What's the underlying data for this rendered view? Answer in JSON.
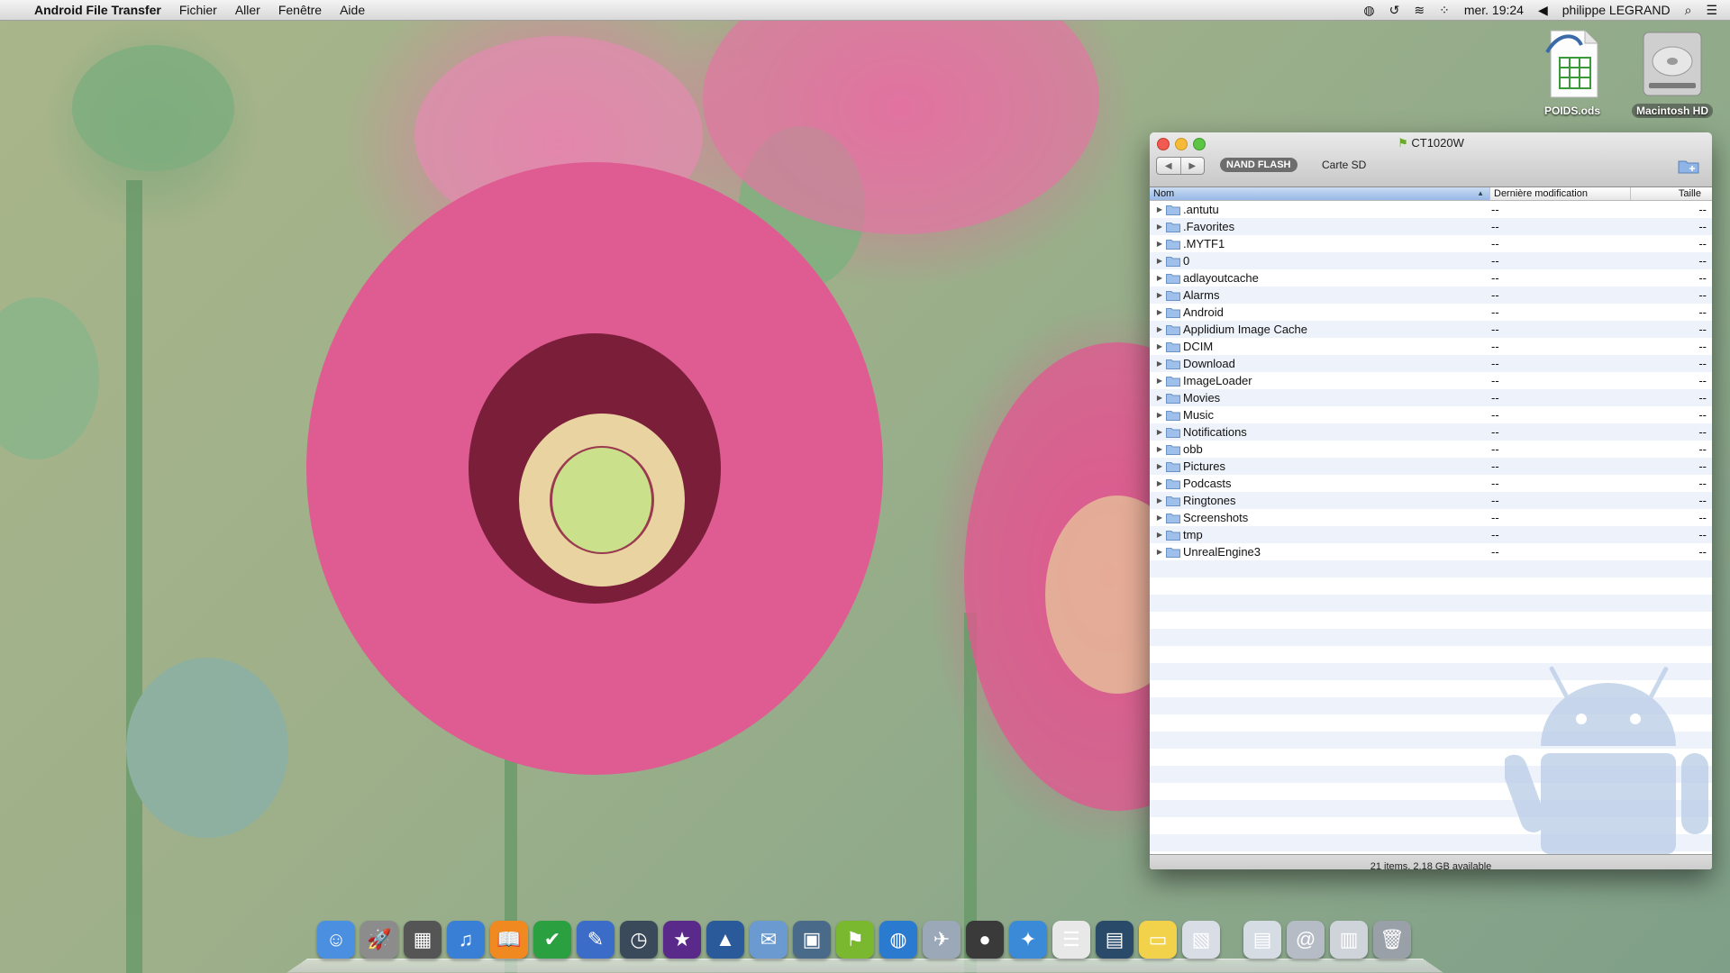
{
  "menubar": {
    "app_name": "Android File Transfer",
    "menus": [
      "Fichier",
      "Aller",
      "Fenêtre",
      "Aide"
    ],
    "clock": "mer. 19:24",
    "user": "philippe LEGRAND"
  },
  "desktop": {
    "icons": [
      {
        "label": "POIDS.ods",
        "icon": "spreadsheet-document-icon"
      },
      {
        "label": "Macintosh HD",
        "icon": "hard-drive-icon"
      }
    ]
  },
  "window": {
    "title": "CT1020W",
    "storage_tabs": [
      "NAND FLASH",
      "Carte SD"
    ],
    "selected_tab": "NAND FLASH",
    "columns": {
      "name": "Nom",
      "date": "Dernière modification",
      "size": "Taille"
    },
    "files": [
      {
        "name": ".antutu",
        "date": "--",
        "size": "--"
      },
      {
        "name": ".Favorites",
        "date": "--",
        "size": "--"
      },
      {
        "name": ".MYTF1",
        "date": "--",
        "size": "--"
      },
      {
        "name": "0",
        "date": "--",
        "size": "--"
      },
      {
        "name": "adlayoutcache",
        "date": "--",
        "size": "--"
      },
      {
        "name": "Alarms",
        "date": "--",
        "size": "--"
      },
      {
        "name": "Android",
        "date": "--",
        "size": "--"
      },
      {
        "name": "Applidium Image Cache",
        "date": "--",
        "size": "--"
      },
      {
        "name": "DCIM",
        "date": "--",
        "size": "--"
      },
      {
        "name": "Download",
        "date": "--",
        "size": "--"
      },
      {
        "name": "ImageLoader",
        "date": "--",
        "size": "--"
      },
      {
        "name": "Movies",
        "date": "--",
        "size": "--"
      },
      {
        "name": "Music",
        "date": "--",
        "size": "--"
      },
      {
        "name": "Notifications",
        "date": "--",
        "size": "--"
      },
      {
        "name": "obb",
        "date": "--",
        "size": "--"
      },
      {
        "name": "Pictures",
        "date": "--",
        "size": "--"
      },
      {
        "name": "Podcasts",
        "date": "--",
        "size": "--"
      },
      {
        "name": "Ringtones",
        "date": "--",
        "size": "--"
      },
      {
        "name": "Screenshots",
        "date": "--",
        "size": "--"
      },
      {
        "name": "tmp",
        "date": "--",
        "size": "--"
      },
      {
        "name": "UnrealEngine3",
        "date": "--",
        "size": "--"
      }
    ],
    "status": "21 items, 2.18 GB available"
  },
  "dock": {
    "apps": [
      {
        "name": "finder-icon",
        "color": "#4a8fe0",
        "glyph": "☺"
      },
      {
        "name": "launchpad-icon",
        "color": "#8c8c8c",
        "glyph": "🚀"
      },
      {
        "name": "mission-control-icon",
        "color": "#555555",
        "glyph": "▦"
      },
      {
        "name": "itunes-icon",
        "color": "#3a7fd6",
        "glyph": "♫"
      },
      {
        "name": "ibooks-icon",
        "color": "#f08a20",
        "glyph": "📖"
      },
      {
        "name": "check-app-icon",
        "color": "#2aa040",
        "glyph": "✔"
      },
      {
        "name": "notes-pad-icon",
        "color": "#3a6cc8",
        "glyph": "✎"
      },
      {
        "name": "time-machine-icon",
        "color": "#3a4a5a",
        "glyph": "◷"
      },
      {
        "name": "imovie-icon",
        "color": "#5a2a8a",
        "glyph": "★"
      },
      {
        "name": "iphoto-icon",
        "color": "#2a5a9a",
        "glyph": "▲"
      },
      {
        "name": "mail-icon",
        "color": "#6a9ad0",
        "glyph": "✉"
      },
      {
        "name": "preview-icon",
        "color": "#4a6a8a",
        "glyph": "▣"
      },
      {
        "name": "android-file-transfer-icon",
        "color": "#7ab830",
        "glyph": "⚑"
      },
      {
        "name": "network-globe-icon",
        "color": "#2a7ad0",
        "glyph": "◍"
      },
      {
        "name": "migration-icon",
        "color": "#9aa8b8",
        "glyph": "✈"
      },
      {
        "name": "facetime-icon",
        "color": "#3a3a3a",
        "glyph": "●"
      },
      {
        "name": "safari-icon",
        "color": "#3a8ad8",
        "glyph": "✦"
      },
      {
        "name": "textedit-icon",
        "color": "#e8e8e8",
        "glyph": "☰"
      },
      {
        "name": "utility-icon",
        "color": "#2a4a6a",
        "glyph": "▤"
      },
      {
        "name": "stickies-icon",
        "color": "#f2d24a",
        "glyph": "▭"
      },
      {
        "name": "preview-doc-icon",
        "color": "#d8dde6",
        "glyph": "▧"
      },
      {
        "name": "pdf-stack-icon",
        "color": "#d6dce4",
        "glyph": "▤"
      },
      {
        "name": "downloads-stack-icon",
        "color": "#b6bcc6",
        "glyph": "@"
      },
      {
        "name": "documents-stack-icon",
        "color": "#cfd4da",
        "glyph": "▥"
      },
      {
        "name": "trash-icon",
        "color": "#9aa0a8",
        "glyph": "🗑"
      }
    ]
  }
}
